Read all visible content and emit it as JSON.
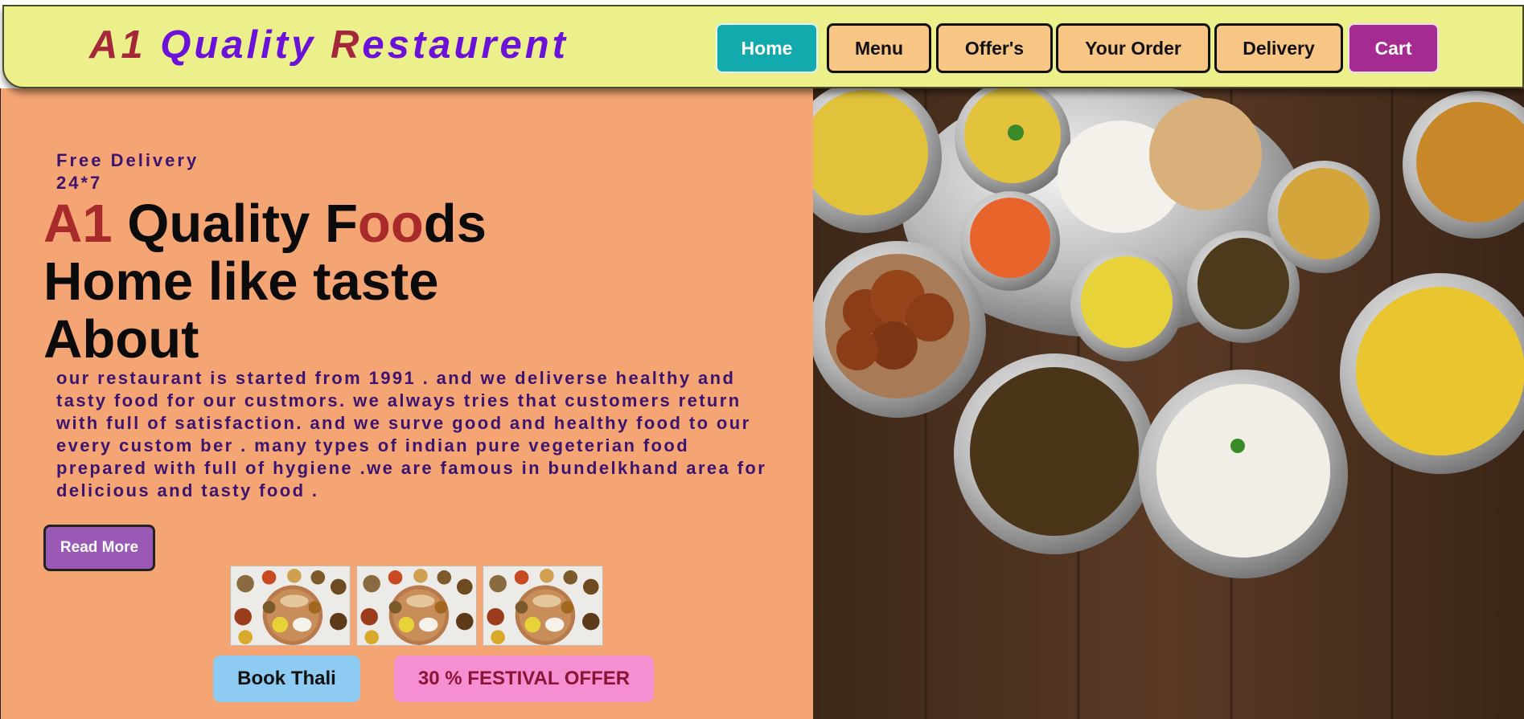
{
  "header": {
    "brand_parts": [
      {
        "text": "A1 ",
        "color": "#a4283a"
      },
      {
        "text": "Quality ",
        "color": "#6a12d8"
      },
      {
        "text": "R",
        "color": "#a4283a"
      },
      {
        "text": "estaurent",
        "color": "#6a12d8"
      }
    ],
    "nav": {
      "home": "Home",
      "menu": "Menu",
      "offers": "Offer's",
      "your_order": "Your Order",
      "delivery": "Delivery",
      "cart": "Cart"
    }
  },
  "hero": {
    "tagline_line1": "Free Delivery",
    "tagline_line2": "24*7",
    "headline_a1": "A1",
    "headline_quality": " Quality F",
    "headline_oo": "oo",
    "headline_ds": "ds",
    "headline_line2": "Home like taste",
    "headline_line3": "About",
    "about_text": "our restaurant is started from 1991 . and we deliverse healthy and tasty food for our custmors. we always tries that customers return with full of satisfaction. and we surve good and healthy food to our every custom ber . many types of indian pure vegeterian food prepared with full of hygiene .we are famous in bundelkhand area for delicious and tasty food .",
    "read_more": "Read More",
    "book_thali": "Book Thali",
    "festival_offer": "30 % FESTIVAL OFFER"
  },
  "images": {
    "thumbnails": [
      "thali-plate-image",
      "thali-plate-image",
      "thali-plate-image"
    ],
    "main": "indian-food-spread-image"
  },
  "colors": {
    "header_bg": "#ebf08b",
    "hero_bg": "#f5a574",
    "home_btn": "#12aaad",
    "cart_btn": "#a52b91",
    "nav_btn": "#f7c685",
    "read_more": "#9b59b6",
    "book_thali": "#8dcbf2",
    "offer": "#f58fd2"
  }
}
